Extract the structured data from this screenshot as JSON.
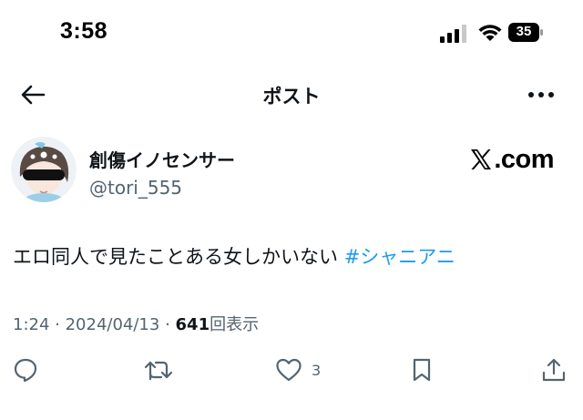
{
  "status_bar": {
    "time": "3:58",
    "battery_level": "35",
    "icons": [
      "signal-icon",
      "wifi-icon",
      "battery-icon"
    ]
  },
  "nav": {
    "title": "ポスト",
    "back_icon": "arrow-left-icon",
    "more_icon": "more-horizontal-icon"
  },
  "post": {
    "author": {
      "display_name": "創傷イノセンサー",
      "handle": "@tori_555"
    },
    "brand": {
      "logo_text": ".com"
    },
    "text": "エロ同人で見たことある女しかいない",
    "hashtag": "#シャニアニ",
    "meta": {
      "time": "1:24",
      "separator": " · ",
      "date": "2024/04/13",
      "views_count": "641",
      "views_label": "回表示"
    },
    "actions": {
      "reply_icon": "reply-icon",
      "repost_icon": "repost-icon",
      "like_icon": "heart-icon",
      "like_count": "3",
      "bookmark_icon": "bookmark-icon",
      "share_icon": "share-icon"
    }
  },
  "colors": {
    "accent": "#1d9bf0",
    "text_primary": "#0f1419",
    "text_secondary": "#536471"
  }
}
